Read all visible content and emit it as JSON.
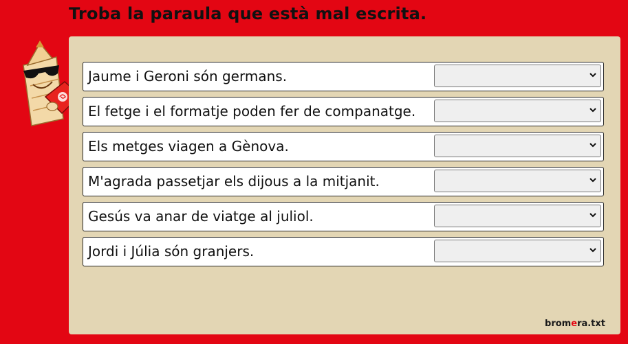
{
  "title": "Troba la paraula que està mal escrita.",
  "rows": [
    {
      "sentence": "Jaume i Geroni són germans.",
      "selected": ""
    },
    {
      "sentence": "El fetge i el formatje poden fer de companatge.",
      "selected": ""
    },
    {
      "sentence": "Els metges viagen a Gènova.",
      "selected": ""
    },
    {
      "sentence": "M'agrada passetjar els dijous a la mitjanit.",
      "selected": ""
    },
    {
      "sentence": "Gesús va anar de viatge al juliol.",
      "selected": ""
    },
    {
      "sentence": "Jordi i Júlia són granjers.",
      "selected": ""
    }
  ],
  "brand": {
    "part1": "brom",
    "part2": "e",
    "part3": "ra.txt"
  },
  "colors": {
    "background": "#e30613",
    "panel": "#e3d6b4",
    "select_bg": "#efefef"
  },
  "icons": {
    "mascot": "pencil-mascot-icon",
    "dropdown": "chevron-down-icon"
  }
}
